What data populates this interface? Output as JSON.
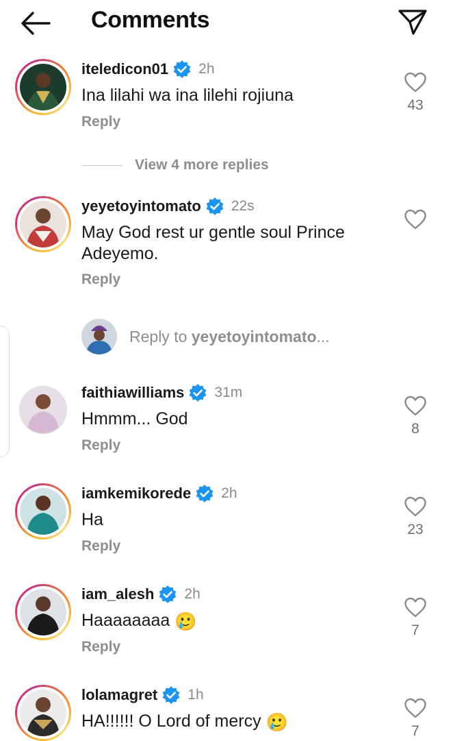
{
  "header": {
    "title": "Comments",
    "back_icon": "arrow-left-icon",
    "send_icon": "paper-plane-icon"
  },
  "colors": {
    "verified": "#1b95f1",
    "muted": "#8e8e8e",
    "ring": "#e1306c"
  },
  "reply_label": "Reply",
  "comments": [
    {
      "username": "iteledicon01",
      "verified": true,
      "time": "2h",
      "text": "Ina lilahi wa ina lilehi rojiuna",
      "likes": "43",
      "story_ring": true
    },
    {
      "username": "yeyetoyintomato",
      "verified": true,
      "time": "22s",
      "text": "May God rest ur gentle soul Prince Adeyemo.",
      "likes": "",
      "story_ring": true
    },
    {
      "username": "faithiawilliams",
      "verified": true,
      "time": "31m",
      "text": "Hmmm... God",
      "likes": "8",
      "story_ring": false
    },
    {
      "username": "iamkemikorede",
      "verified": true,
      "time": "2h",
      "text": "Ha",
      "likes": "23",
      "story_ring": true
    },
    {
      "username": "iam_alesh",
      "verified": true,
      "time": "2h",
      "text": "Haaaaaaaa",
      "emoji": "🥲",
      "likes": "7",
      "story_ring": true
    },
    {
      "username": "lolamagret",
      "verified": true,
      "time": "1h",
      "text": "HA!!!!!! O Lord of mercy",
      "emoji": "🥲",
      "likes": "7",
      "story_ring": true
    }
  ],
  "view_more_replies": "View 4 more replies",
  "reply_input": {
    "prefix": "Reply to ",
    "target": "yeyetoyintomato",
    "suffix": "..."
  }
}
